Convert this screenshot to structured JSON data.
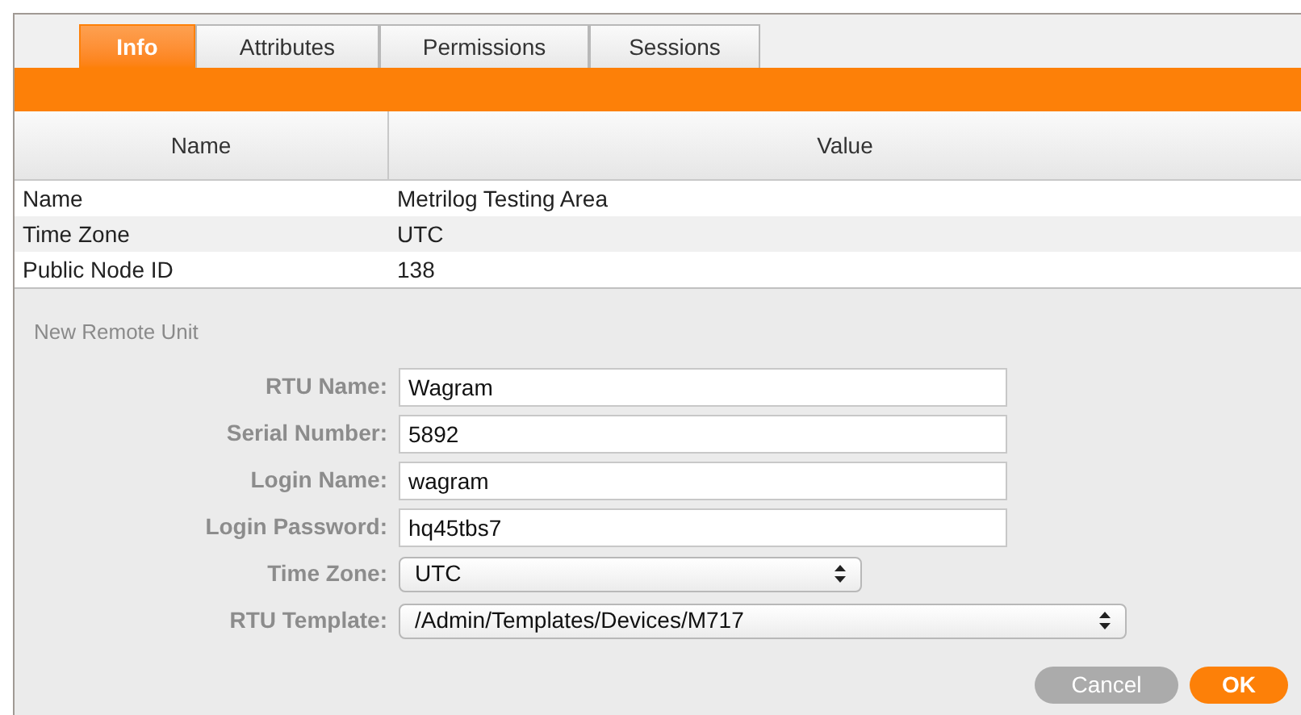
{
  "tabs": [
    {
      "label": "Info",
      "selected": true
    },
    {
      "label": "Attributes",
      "selected": false
    },
    {
      "label": "Permissions",
      "selected": false
    },
    {
      "label": "Sessions",
      "selected": false
    }
  ],
  "table": {
    "columns": [
      "Name",
      "Value"
    ],
    "rows": [
      {
        "name": "Name",
        "value": "Metrilog Testing Area"
      },
      {
        "name": "Time Zone",
        "value": "UTC"
      },
      {
        "name": "Public Node ID",
        "value": "138"
      }
    ]
  },
  "form": {
    "title": "New Remote Unit",
    "fields": [
      {
        "label": "RTU Name:",
        "kind": "text",
        "value": "Wagram"
      },
      {
        "label": "Serial Number:",
        "kind": "text",
        "value": "5892"
      },
      {
        "label": "Login Name:",
        "kind": "text",
        "value": "wagram"
      },
      {
        "label": "Login Password:",
        "kind": "text",
        "value": "hq45tbs7"
      },
      {
        "label": "Time Zone:",
        "kind": "select",
        "value": "UTC"
      },
      {
        "label": "RTU Template:",
        "kind": "wideselect",
        "value": "/Admin/Templates/Devices/M717"
      }
    ]
  },
  "buttons": [
    {
      "label": "Cancel",
      "kind": "secondary"
    },
    {
      "label": "OK",
      "kind": "primary"
    }
  ]
}
